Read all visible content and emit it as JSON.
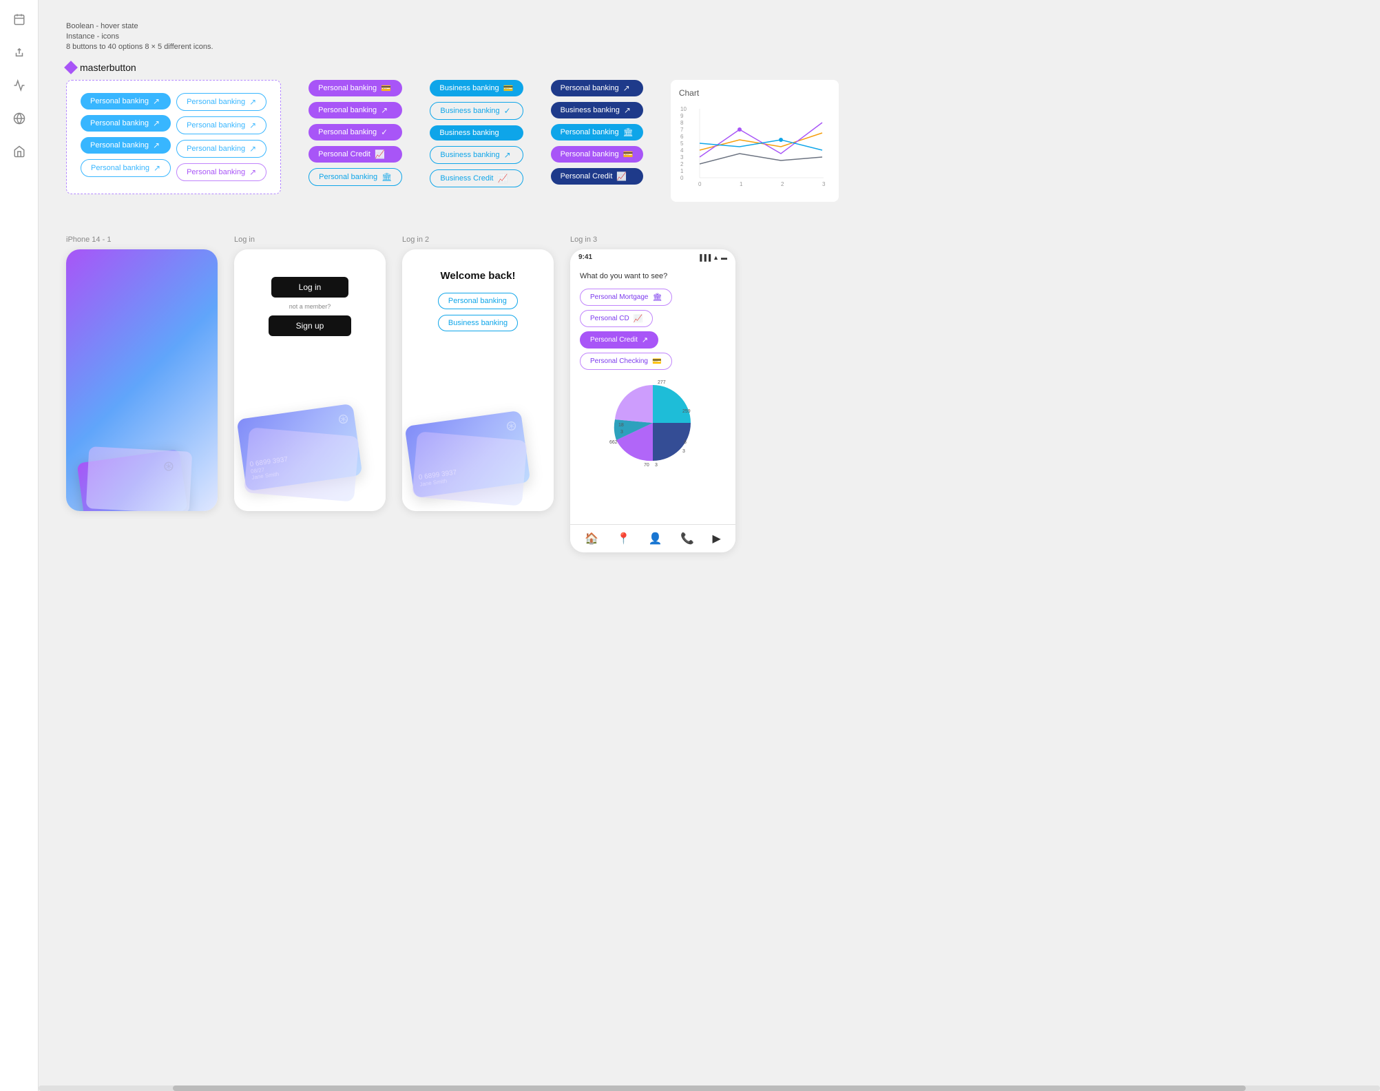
{
  "meta": {
    "title": "Boolean - hover state",
    "instance": "Instance - icons",
    "description": "8 buttons to 40 options  8 × 5 different icons.",
    "masterbutton_label": "masterbutton"
  },
  "sidebar": {
    "icons": [
      {
        "name": "calendar-icon",
        "glyph": "📅"
      },
      {
        "name": "export-icon",
        "glyph": "↗"
      },
      {
        "name": "chart-icon",
        "glyph": "📈"
      },
      {
        "name": "globe-icon",
        "glyph": "🌐"
      },
      {
        "name": "home-icon",
        "glyph": "🏠"
      }
    ]
  },
  "dashed_buttons": {
    "col1": [
      {
        "label": "Personal banking",
        "style": "filled-blue",
        "icon": "↗"
      },
      {
        "label": "Personal banking",
        "style": "filled-blue",
        "icon": "↗"
      },
      {
        "label": "Personal banking",
        "style": "filled-blue",
        "icon": "↗"
      },
      {
        "label": "Personal banking",
        "style": "outline-blue",
        "icon": "↗"
      }
    ],
    "col2": [
      {
        "label": "Personal banking",
        "style": "outline-blue",
        "icon": "↗"
      },
      {
        "label": "Personal banking",
        "style": "outline-blue",
        "icon": "↗"
      },
      {
        "label": "Personal banking",
        "style": "outline-blue",
        "icon": "↗"
      },
      {
        "label": "Personal banking",
        "style": "outline-purple",
        "icon": "↗"
      }
    ]
  },
  "col3_buttons": [
    {
      "label": "Personal banking",
      "style": "filled-purple",
      "icon": "💳"
    },
    {
      "label": "Personal banking",
      "style": "filled-purple",
      "icon": "↗"
    },
    {
      "label": "Personal banking",
      "style": "filled-purple",
      "icon": "✓"
    },
    {
      "label": "Personal Credit",
      "style": "filled-purple",
      "icon": "📈"
    },
    {
      "label": "Personal banking",
      "style": "outline-teal",
      "icon": "🏛"
    }
  ],
  "col4_buttons": [
    {
      "label": "Business banking",
      "style": "filled-teal",
      "icon": "💳"
    },
    {
      "label": "Business banking",
      "style": "outline-teal",
      "icon": "✓"
    },
    {
      "label": "Business banking",
      "style": "filled-teal",
      "icon": ""
    },
    {
      "label": "Business banking",
      "style": "outline-teal",
      "icon": "↗"
    },
    {
      "label": "Business Credit",
      "style": "outline-teal",
      "icon": "📈"
    }
  ],
  "col5_buttons": [
    {
      "label": "Personal banking",
      "style": "filled-darkblue",
      "icon": "↗"
    },
    {
      "label": "Business banking",
      "style": "filled-darkblue",
      "icon": "↗"
    },
    {
      "label": "Personal banking",
      "style": "filled-teal",
      "icon": "🏛"
    },
    {
      "label": "Personal banking",
      "style": "filled-purple",
      "icon": "💳"
    },
    {
      "label": "Personal Credit",
      "style": "filled-darkblue",
      "icon": "📈"
    }
  ],
  "chart": {
    "title": "Chart",
    "x_labels": [
      "0",
      "1",
      "2",
      "3"
    ],
    "y_labels": [
      "0",
      "1",
      "2",
      "3",
      "4",
      "5",
      "6",
      "7",
      "8",
      "9",
      "10"
    ]
  },
  "phones": {
    "phone1": {
      "label": "iPhone 14 - 1"
    },
    "phone2": {
      "label": "Log in",
      "login_btn": "Log in",
      "not_member": "not a member?",
      "signup_btn": "Sign up",
      "card_number": "0 6899 3937",
      "card_date": "08/27",
      "card_name": "Jane Smith"
    },
    "phone3": {
      "label": "Log in 2",
      "welcome": "Welcome back!",
      "btn1": "Personal banking",
      "btn2": "Business banking",
      "card_number": "0 6899 3937",
      "card_name": "Jane Smith"
    },
    "phone4": {
      "label": "Log in 3",
      "time": "9:41",
      "question": "What do you want to see?",
      "btn1": "Personal Mortgage",
      "btn2": "Personal CD",
      "btn3": "Personal Credit",
      "btn4": "Personal Checking",
      "pie_values": [
        277,
        259,
        8,
        3,
        662,
        70,
        3,
        18,
        3
      ],
      "nav_icons": [
        "🏠",
        "📍",
        "👤",
        "📞",
        "▶"
      ]
    }
  }
}
